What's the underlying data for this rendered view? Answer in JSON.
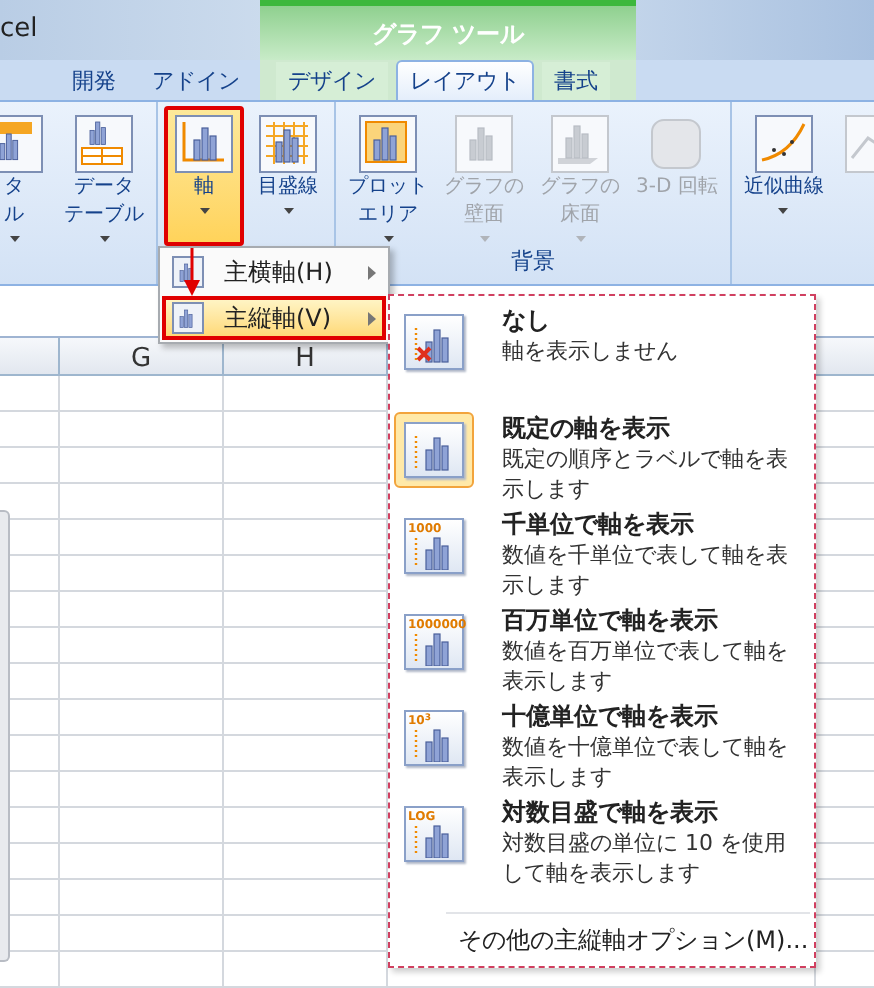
{
  "app_title": "cel",
  "contextual_group": {
    "label": "グラフ ツール"
  },
  "tabs": [
    {
      "label": "開発",
      "selected": false,
      "contextual": false
    },
    {
      "label": "アドイン",
      "selected": false,
      "contextual": false
    },
    {
      "label": "デザイン",
      "selected": false,
      "contextual": true
    },
    {
      "label": "レイアウト",
      "selected": true,
      "contextual": true
    },
    {
      "label": "書式",
      "selected": false,
      "contextual": true
    }
  ],
  "ribbon_groups": [
    {
      "buttons": [
        {
          "kind": "data-label",
          "lines": [
            "タ",
            "ル"
          ],
          "dropdown": true,
          "disabled": false,
          "selected": false
        },
        {
          "kind": "data-table",
          "lines": [
            "データ",
            "テーブル"
          ],
          "dropdown": true,
          "disabled": false,
          "selected": false
        }
      ]
    },
    {
      "buttons": [
        {
          "kind": "axis",
          "lines": [
            "軸"
          ],
          "dropdown": true,
          "disabled": false,
          "selected": true
        },
        {
          "kind": "gridlines",
          "lines": [
            "目盛線"
          ],
          "dropdown": true,
          "disabled": false,
          "selected": false
        }
      ]
    },
    {
      "label": "背景",
      "buttons": [
        {
          "kind": "plot-area",
          "lines": [
            "プロット",
            "エリア"
          ],
          "dropdown": true,
          "disabled": false,
          "selected": false
        },
        {
          "kind": "wall",
          "lines": [
            "グラフの",
            "壁面"
          ],
          "dropdown": true,
          "disabled": true,
          "selected": false
        },
        {
          "kind": "floor",
          "lines": [
            "グラフの",
            "床面"
          ],
          "dropdown": true,
          "disabled": true,
          "selected": false
        },
        {
          "kind": "rotate",
          "lines": [
            "3-D 回転"
          ],
          "dropdown": false,
          "disabled": true,
          "selected": false
        }
      ]
    },
    {
      "buttons": [
        {
          "kind": "trendline",
          "lines": [
            "近似曲線"
          ],
          "dropdown": true,
          "disabled": false,
          "selected": false
        },
        {
          "kind": "line",
          "dropdown": false,
          "disabled": true,
          "selected": false
        }
      ]
    }
  ],
  "columns": [
    {
      "label": "G"
    },
    {
      "label": "H"
    }
  ],
  "axis_menu": {
    "items": [
      {
        "label": "主横軸(H)",
        "selected": false
      },
      {
        "label": "主縦軸(V)",
        "selected": true
      }
    ]
  },
  "vertical_axis_menu": {
    "options": [
      {
        "kind": "none",
        "title": "なし",
        "description": "軸を表示しません",
        "selected": false
      },
      {
        "kind": "default",
        "title": "既定の軸を表示",
        "description": "既定の順序とラベルで軸を表示します",
        "selected": true
      },
      {
        "kind": "scaled",
        "icon_label": "1000",
        "title": "千単位で軸を表示",
        "description": "数値を千単位で表して軸を表示します",
        "selected": false
      },
      {
        "kind": "scaled",
        "icon_label": "1000000",
        "title": "百万単位で軸を表示",
        "description": "数値を百万単位で表して軸を表示します",
        "selected": false
      },
      {
        "kind": "scaled",
        "icon_label": "10$^{3}$",
        "title": "十億単位で軸を表示",
        "description": "数値を十億単位で表して軸を表示します",
        "selected": false
      },
      {
        "kind": "scaled",
        "icon_label": "LOG",
        "title": "対数目盛で軸を表示",
        "description": "対数目盛の単位に 10 を使用して軸を表示します",
        "selected": false
      }
    ],
    "more": "その他の主縦軸オプション(M)..."
  }
}
